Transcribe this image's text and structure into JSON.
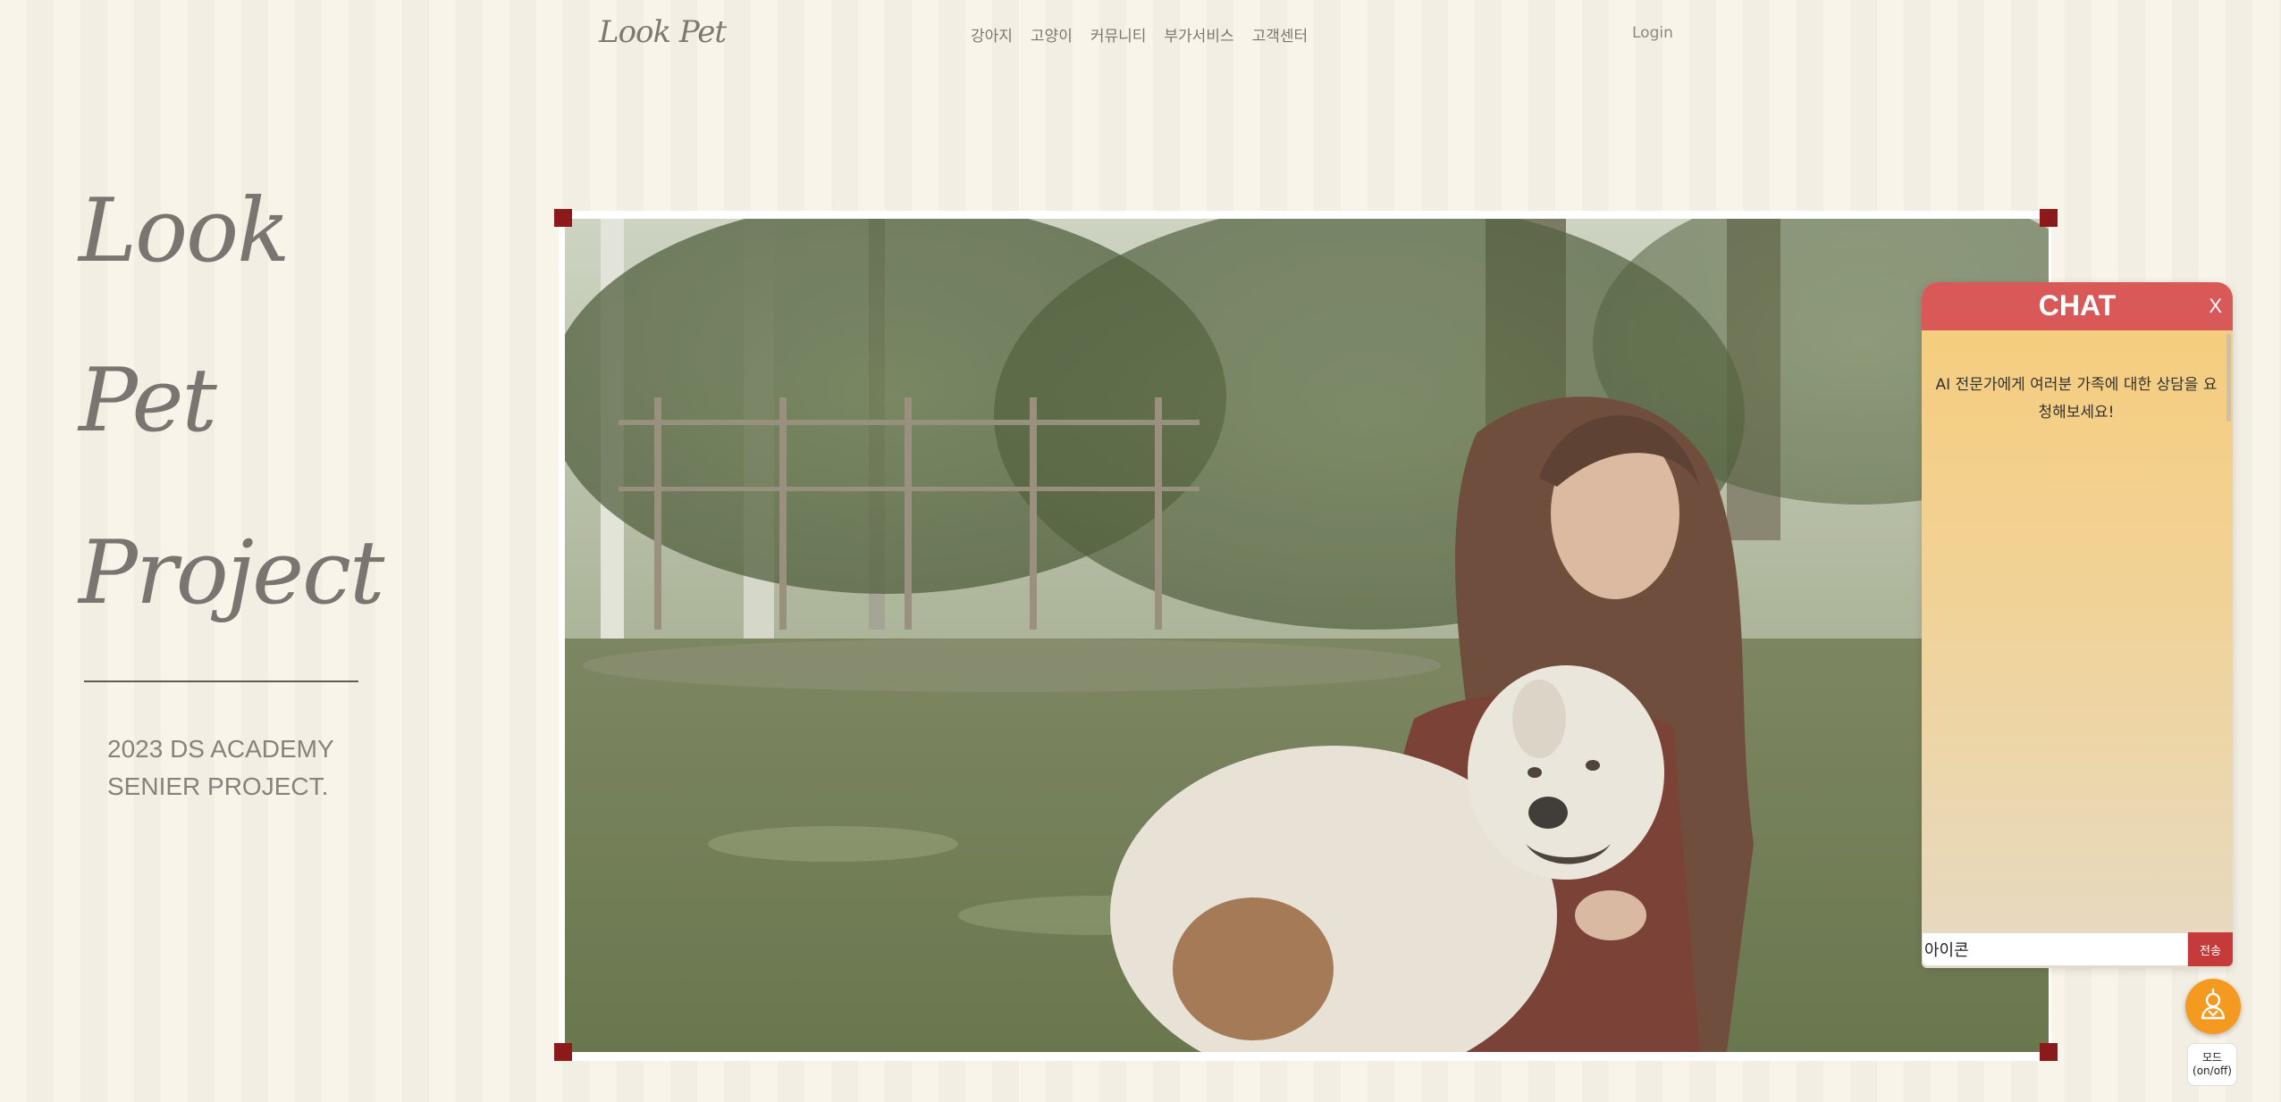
{
  "header": {
    "logo": "Look Pet",
    "nav": [
      "강아지",
      "고양이",
      "커뮤니티",
      "부가서비스",
      "고객센터"
    ],
    "login": "Login"
  },
  "hero": {
    "words": [
      "Look",
      "Pet",
      "Project"
    ],
    "subtitle_line1": "2023 DS ACADEMY",
    "subtitle_line2": "SENIER PROJECT."
  },
  "chat": {
    "title": "CHAT",
    "close": "X",
    "message": "AI 전문가에게 여러분 가족에 대한 상담을 요청해보세요!",
    "input_value": "아이콘",
    "send_label": "전송"
  },
  "widgets": {
    "fab_icon": "assistant-icon",
    "mode_label_line1": "모드",
    "mode_label_line2": "(on/off)"
  },
  "colors": {
    "accent_red": "#d95858",
    "send_red": "#c53b3b",
    "fab_orange": "#f59a20",
    "corner_red": "#8c1a1a"
  }
}
